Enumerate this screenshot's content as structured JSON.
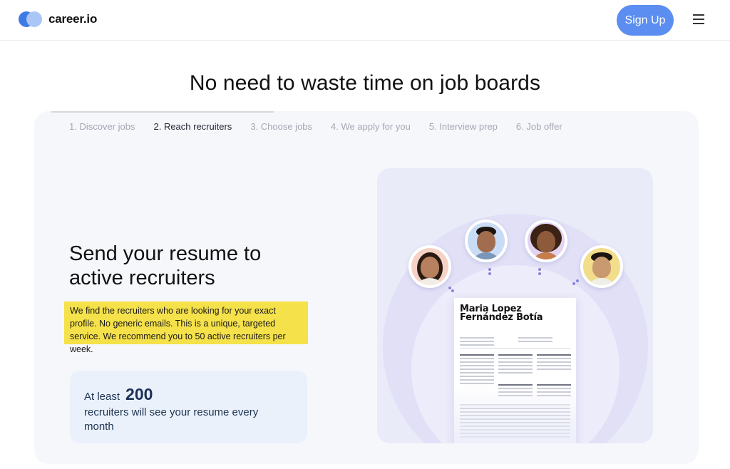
{
  "header": {
    "logo_text": "career.io",
    "signup_label": "Sign Up",
    "menu_icon": "hamburger-menu-icon"
  },
  "page_title": "No need to waste time on job boards",
  "steps": [
    {
      "label": "1. Discover jobs",
      "active": false
    },
    {
      "label": "2. Reach recruiters",
      "active": true
    },
    {
      "label": "3. Choose jobs",
      "active": false
    },
    {
      "label": "4. We apply for you",
      "active": false
    },
    {
      "label": "5. Interview prep",
      "active": false
    },
    {
      "label": "6. Job offer",
      "active": false
    }
  ],
  "feature": {
    "title": "Send your resume to active recruiters",
    "highlight_text": "We find the recruiters who are looking for your exact profile. No generic emails. This is a unique, targeted service. We recommend you to 50 active recruiters per week.",
    "stat_prefix": "At least",
    "stat_number": "200",
    "stat_suffix": "recruiters will see your resume every month"
  },
  "illustration": {
    "resume_name": "Maria Lopez Fernández Botía"
  },
  "colors": {
    "accent": "#5b8ef0",
    "highlight": "#f5e14a",
    "stat_bg": "#eaf1fb",
    "card_bg": "#f6f7fb"
  }
}
